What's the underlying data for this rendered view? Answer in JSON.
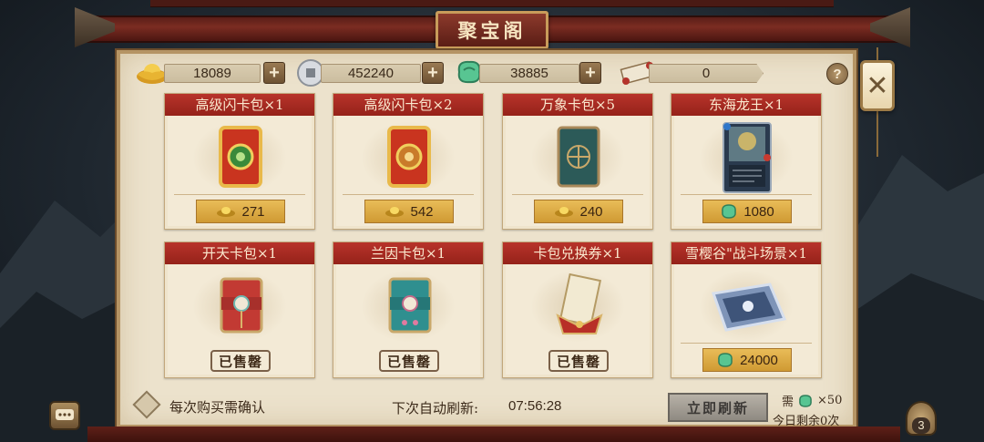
{
  "title": "聚宝阁",
  "resources": [
    {
      "icon": "gold-ingot-icon",
      "value": "18089"
    },
    {
      "icon": "silver-coin-icon",
      "value": "452240"
    },
    {
      "icon": "jade-icon",
      "value": "38885"
    },
    {
      "icon": "scroll-icon",
      "value": "0"
    }
  ],
  "help_label": "?",
  "close_label": "✕",
  "cards": [
    {
      "title": "高级闪卡包×1",
      "currency_icon": "gold-ingot-icon",
      "price": "271",
      "sold": false
    },
    {
      "title": "高级闪卡包×2",
      "currency_icon": "gold-ingot-icon",
      "price": "542",
      "sold": false
    },
    {
      "title": "万象卡包×5",
      "currency_icon": "gold-ingot-icon",
      "price": "240",
      "sold": false
    },
    {
      "title": "东海龙王×1",
      "currency_icon": "jade-icon",
      "price": "1080",
      "sold": false
    },
    {
      "title": "开天卡包×1",
      "sold": true,
      "sold_label": "已售罄"
    },
    {
      "title": "兰因卡包×1",
      "sold": true,
      "sold_label": "已售罄"
    },
    {
      "title": "卡包兑换券×1",
      "sold": true,
      "sold_label": "已售罄"
    },
    {
      "title": "雪樱谷\"战斗场景×1",
      "currency_icon": "jade-icon",
      "price": "24000",
      "sold": false
    }
  ],
  "bottom": {
    "confirm_label": "每次购买需确认",
    "refresh_label": "下次自动刷新:",
    "refresh_time": "07:56:28",
    "refresh_button": "立即刷新",
    "cost_prefix": "需",
    "cost_amount": "×50",
    "remaining": "今日剩余0次"
  },
  "bag_count": "3",
  "colors": {
    "title_red": "#b8332b",
    "parchment": "#ece2cc",
    "gold_tag": "#e2b04c",
    "jade": "#49b98a"
  }
}
